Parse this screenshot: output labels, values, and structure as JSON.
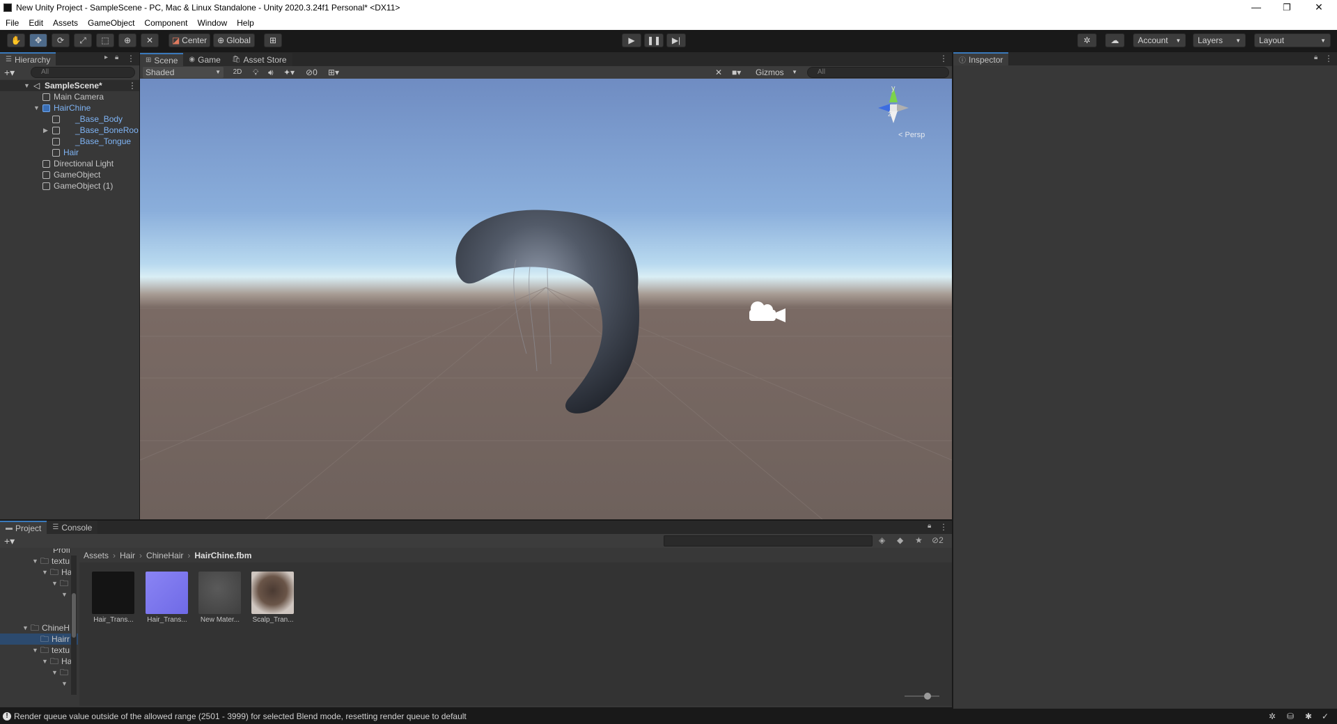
{
  "window": {
    "title": "New Unity Project - SampleScene - PC, Mac & Linux Standalone - Unity 2020.3.24f1 Personal* <DX11>",
    "minimize": "—",
    "restore": "❐",
    "close": "✕"
  },
  "menu": [
    "File",
    "Edit",
    "Assets",
    "GameObject",
    "Component",
    "Window",
    "Help"
  ],
  "toolbar": {
    "pivot": "Center",
    "space": "Global",
    "account": "Account",
    "layers": "Layers",
    "layout": "Layout"
  },
  "hierarchy": {
    "tab": "Hierarchy",
    "search_placeholder": "All",
    "items": [
      {
        "label": "SampleScene*"
      },
      {
        "label": "Main Camera"
      },
      {
        "label": "HairChine"
      },
      {
        "label": "_Base_Body"
      },
      {
        "label": "_Base_BoneRoo"
      },
      {
        "label": "_Base_Tongue"
      },
      {
        "label": "Hair"
      },
      {
        "label": "Directional Light"
      },
      {
        "label": "GameObject"
      },
      {
        "label": "GameObject (1)"
      }
    ]
  },
  "scene": {
    "tabs": [
      "Scene",
      "Game",
      "Asset Store"
    ],
    "shading": "Shaded",
    "mode_2d": "2D",
    "hidden_count": "0",
    "gizmos": "Gizmos",
    "search_placeholder": "All",
    "persp": "< Persp",
    "axis_y": "y",
    "axis_z": "z"
  },
  "inspector": {
    "tab": "Inspector"
  },
  "project": {
    "tabs": [
      "Project",
      "Console"
    ],
    "breadcrumb": [
      "Assets",
      "Hair",
      "ChineHair",
      "HairChine.fbm"
    ],
    "hidden_packages": "2",
    "tree": [
      {
        "label": "Profi"
      },
      {
        "label": "textu"
      },
      {
        "label": "Ha"
      },
      {
        "label": ""
      },
      {
        "label": ""
      },
      {
        "label": "ChineH"
      },
      {
        "label": "Hairr"
      },
      {
        "label": "textu"
      },
      {
        "label": "Ha"
      },
      {
        "label": ""
      },
      {
        "label": ""
      }
    ],
    "assets": [
      {
        "label": "Hair_Trans...",
        "color": "#141414"
      },
      {
        "label": "Hair_Trans...",
        "color": "#7d78f0"
      },
      {
        "label": "New Mater...",
        "color": "#4e4e4e"
      },
      {
        "label": "Scalp_Tran...",
        "color": "#6a5548"
      }
    ]
  },
  "status": {
    "message": "Render queue value outside of the allowed range (2501 - 3999) for selected Blend mode, resetting render queue to default"
  }
}
